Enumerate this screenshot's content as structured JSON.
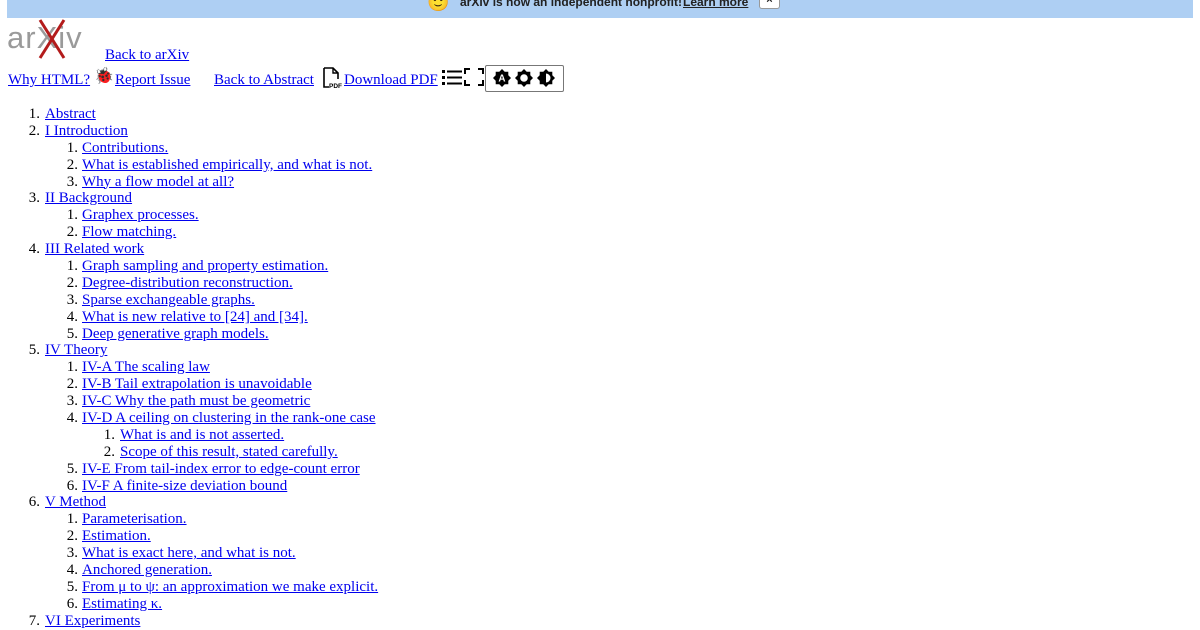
{
  "banner": {
    "emoji": "🙂",
    "message": "arXiv is now an independent nonprofit!",
    "learn_more": "Learn more",
    "close": "×",
    "bg_color": "#aecff3"
  },
  "header": {
    "logo_text": "arXiv",
    "back_to_arxiv": "Back to arXiv"
  },
  "toolbar": {
    "why_html": "Why HTML?",
    "report_issue": "Report Issue",
    "back_to_abstract": "Back to Abstract",
    "download_pdf": "Download PDF",
    "icons": [
      "bug-icon",
      "pdf-icon",
      "toc-icon",
      "expand-icon",
      "theme-auto-icon",
      "theme-light-icon",
      "theme-dark-icon"
    ]
  },
  "toc": [
    {
      "num": "1.",
      "label": "Abstract",
      "level": 1
    },
    {
      "num": "2.",
      "label": "I Introduction",
      "level": 1
    },
    {
      "num": "1.",
      "label": "Contributions.",
      "level": 2
    },
    {
      "num": "2.",
      "label": "What is established empirically, and what is not.",
      "level": 2
    },
    {
      "num": "3.",
      "label": "Why a flow model at all?",
      "level": 2
    },
    {
      "num": "3.",
      "label": "II Background",
      "level": 1
    },
    {
      "num": "1.",
      "label": "Graphex processes.",
      "level": 2
    },
    {
      "num": "2.",
      "label": "Flow matching.",
      "level": 2
    },
    {
      "num": "4.",
      "label": "III Related work",
      "level": 1
    },
    {
      "num": "1.",
      "label": "Graph sampling and property estimation.",
      "level": 2
    },
    {
      "num": "2.",
      "label": "Degree-distribution reconstruction.",
      "level": 2
    },
    {
      "num": "3.",
      "label": "Sparse exchangeable graphs.",
      "level": 2
    },
    {
      "num": "4.",
      "label": "What is new relative to [24] and [34].",
      "level": 2
    },
    {
      "num": "5.",
      "label": "Deep generative graph models.",
      "level": 2
    },
    {
      "num": "5.",
      "label": "IV Theory",
      "level": 1
    },
    {
      "num": "1.",
      "label": "IV-A The scaling law",
      "level": 2
    },
    {
      "num": "2.",
      "label": "IV-B Tail extrapolation is unavoidable",
      "level": 2
    },
    {
      "num": "3.",
      "label": "IV-C Why the path must be geometric",
      "level": 2
    },
    {
      "num": "4.",
      "label": "IV-D A ceiling on clustering in the rank-one case",
      "level": 2
    },
    {
      "num": "1.",
      "label": "What is and is not asserted.",
      "level": 3
    },
    {
      "num": "2.",
      "label": "Scope of this result, stated carefully.",
      "level": 3
    },
    {
      "num": "5.",
      "label": "IV-E From tail-index error to edge-count error",
      "level": 2
    },
    {
      "num": "6.",
      "label": "IV-F A finite-size deviation bound",
      "level": 2
    },
    {
      "num": "6.",
      "label": "V Method",
      "level": 1
    },
    {
      "num": "1.",
      "label": "Parameterisation.",
      "level": 2
    },
    {
      "num": "2.",
      "label": "Estimation.",
      "level": 2
    },
    {
      "num": "3.",
      "label": "What is exact here, and what is not.",
      "level": 2
    },
    {
      "num": "4.",
      "label": "Anchored generation.",
      "level": 2
    },
    {
      "num": "5.",
      "label": "From μ to ψ: an approximation we make explicit.",
      "level": 2
    },
    {
      "num": "6.",
      "label": "Estimating κ.",
      "level": 2
    },
    {
      "num": "7.",
      "label": "VI Experiments",
      "level": 1
    }
  ]
}
